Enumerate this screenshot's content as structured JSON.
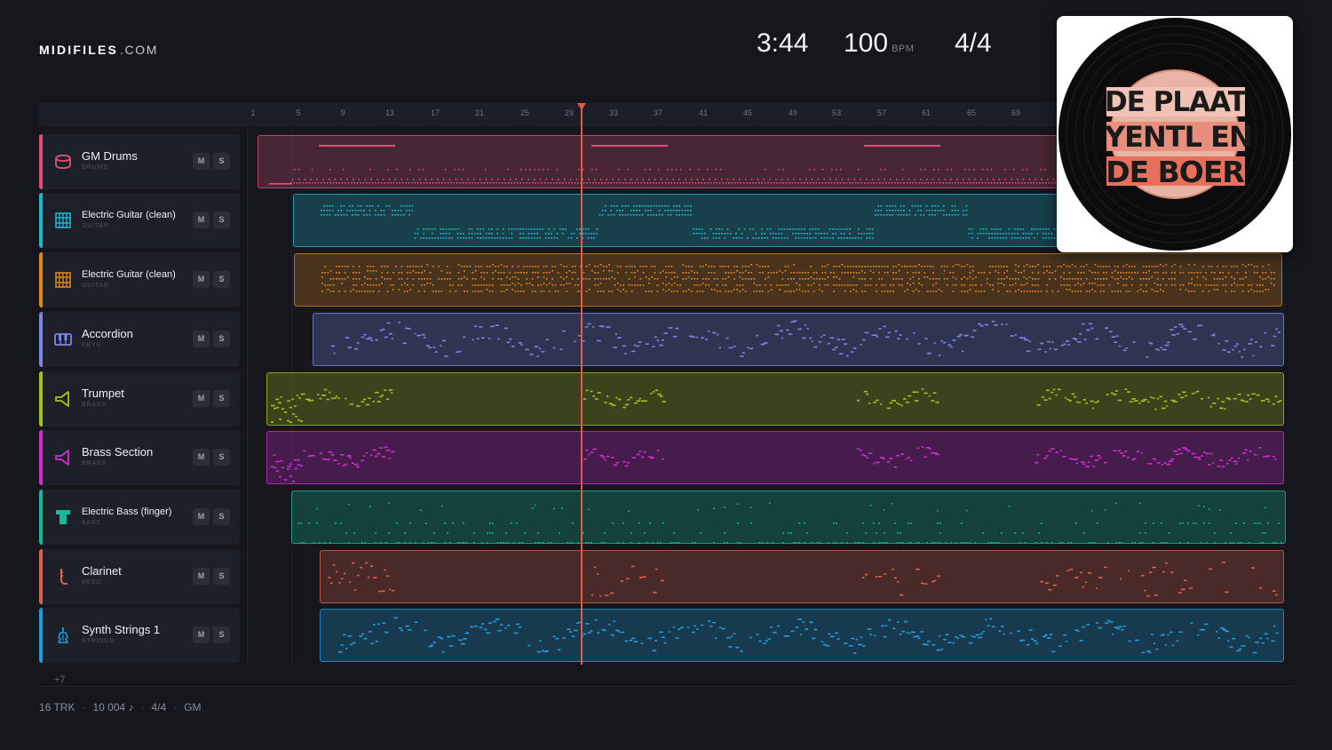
{
  "app": {
    "logo_brand": "MIDIFILES",
    "logo_tld": ".COM"
  },
  "transport": {
    "time": "3:44",
    "tempo": "100",
    "tempo_unit": "BPM",
    "time_signature": "4/4"
  },
  "ruler": {
    "ticks": [
      "1",
      "5",
      "9",
      "13",
      "17",
      "21",
      "25",
      "29",
      "33",
      "37",
      "41",
      "45",
      "49",
      "53",
      "57",
      "61",
      "65",
      "69"
    ]
  },
  "tracks": [
    {
      "name": "GM Drums",
      "category": "DRUMS",
      "color": "#e0507a",
      "icon": "drum-icon",
      "mute_label": "M",
      "solo_label": "S"
    },
    {
      "name": "Electric Guitar (clean)",
      "category": "GUITAR",
      "color": "#1fb6cf",
      "icon": "guitar-fretboard-icon",
      "mute_label": "M",
      "solo_label": "S"
    },
    {
      "name": "Electric Guitar (clean)",
      "category": "GUITAR",
      "color": "#e0851f",
      "icon": "guitar-fretboard-icon",
      "mute_label": "M",
      "solo_label": "S"
    },
    {
      "name": "Accordion",
      "category": "KEYS",
      "color": "#7b86e8",
      "icon": "piano-keys-icon",
      "mute_label": "M",
      "solo_label": "S"
    },
    {
      "name": "Trumpet",
      "category": "BRASS",
      "color": "#a6c21c",
      "icon": "horn-icon",
      "mute_label": "M",
      "solo_label": "S"
    },
    {
      "name": "Brass Section",
      "category": "BRASS",
      "color": "#d42bd6",
      "icon": "horn-icon",
      "mute_label": "M",
      "solo_label": "S"
    },
    {
      "name": "Electric Bass (finger)",
      "category": "BASS",
      "color": "#19b89a",
      "icon": "bass-icon",
      "mute_label": "M",
      "solo_label": "S"
    },
    {
      "name": "Clarinet",
      "category": "REED",
      "color": "#e0604a",
      "icon": "reed-icon",
      "mute_label": "M",
      "solo_label": "S"
    },
    {
      "name": "Synth Strings 1",
      "category": "STRINGS",
      "color": "#1e9ee0",
      "icon": "strings-icon",
      "mute_label": "M",
      "solo_label": "S"
    }
  ],
  "more_tracks": "+7",
  "footer": {
    "tracks": "16 TRK",
    "notes": "10 004 ♪",
    "time_signature": "4/4",
    "standard": "GM"
  },
  "album": {
    "lines": [
      "DE PLAAT",
      "YENTL EN",
      "DE BOER"
    ]
  }
}
